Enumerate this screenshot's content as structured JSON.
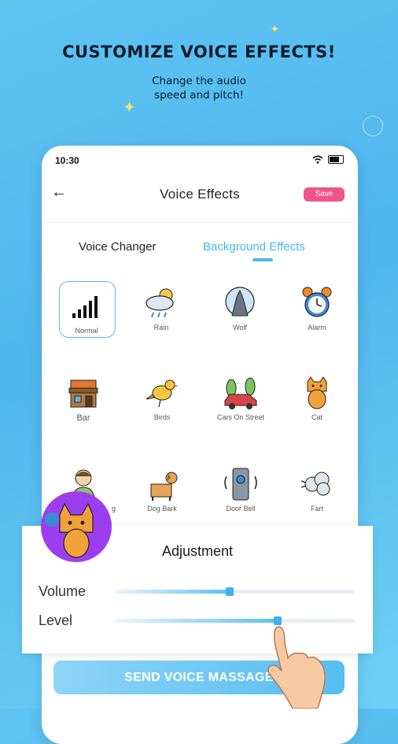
{
  "promo": {
    "headline": "CUSTOMIZE VOICE EFFECTS!",
    "sub_line1": "Change the audio",
    "sub_line2": "speed and pitch!"
  },
  "status_bar": {
    "time": "10:30"
  },
  "header": {
    "title": "Voice Effects",
    "save_label": "Save",
    "back_icon": "arrow-left-icon"
  },
  "tabs": [
    {
      "label": "Voice Changer",
      "active": false
    },
    {
      "label": "Background Effects",
      "active": true
    }
  ],
  "effects": [
    {
      "label": "Normal",
      "icon": "bars-icon",
      "selected": true
    },
    {
      "label": "Rain",
      "icon": "rain-cloud-icon"
    },
    {
      "label": "Wolf",
      "icon": "wolf-icon"
    },
    {
      "label": "Alarm",
      "icon": "alarm-clock-icon"
    },
    {
      "label": "Bar",
      "icon": "bar-icon"
    },
    {
      "label": "Birds",
      "icon": "bird-icon"
    },
    {
      "label": "Cars On Street",
      "icon": "car-icon"
    },
    {
      "label": "Cat",
      "icon": "cat-icon"
    },
    {
      "label": "g",
      "icon": "person-icon"
    },
    {
      "label": "Dog Bark",
      "icon": "dog-icon"
    },
    {
      "label": "Door Bell",
      "icon": "door-bell-icon"
    },
    {
      "label": "Fart",
      "icon": "fart-cloud-icon"
    }
  ],
  "adjustment": {
    "title": "Adjustment",
    "volume_label": "Volume",
    "volume_level": 0.48,
    "level_label": "Level",
    "level_level": 0.68
  },
  "send_button": {
    "label": "SEND VOICE MASSAGE"
  },
  "colors": {
    "accent": "#48b8ef",
    "save": "#f0548a",
    "avatar": "#9c3ef0"
  }
}
